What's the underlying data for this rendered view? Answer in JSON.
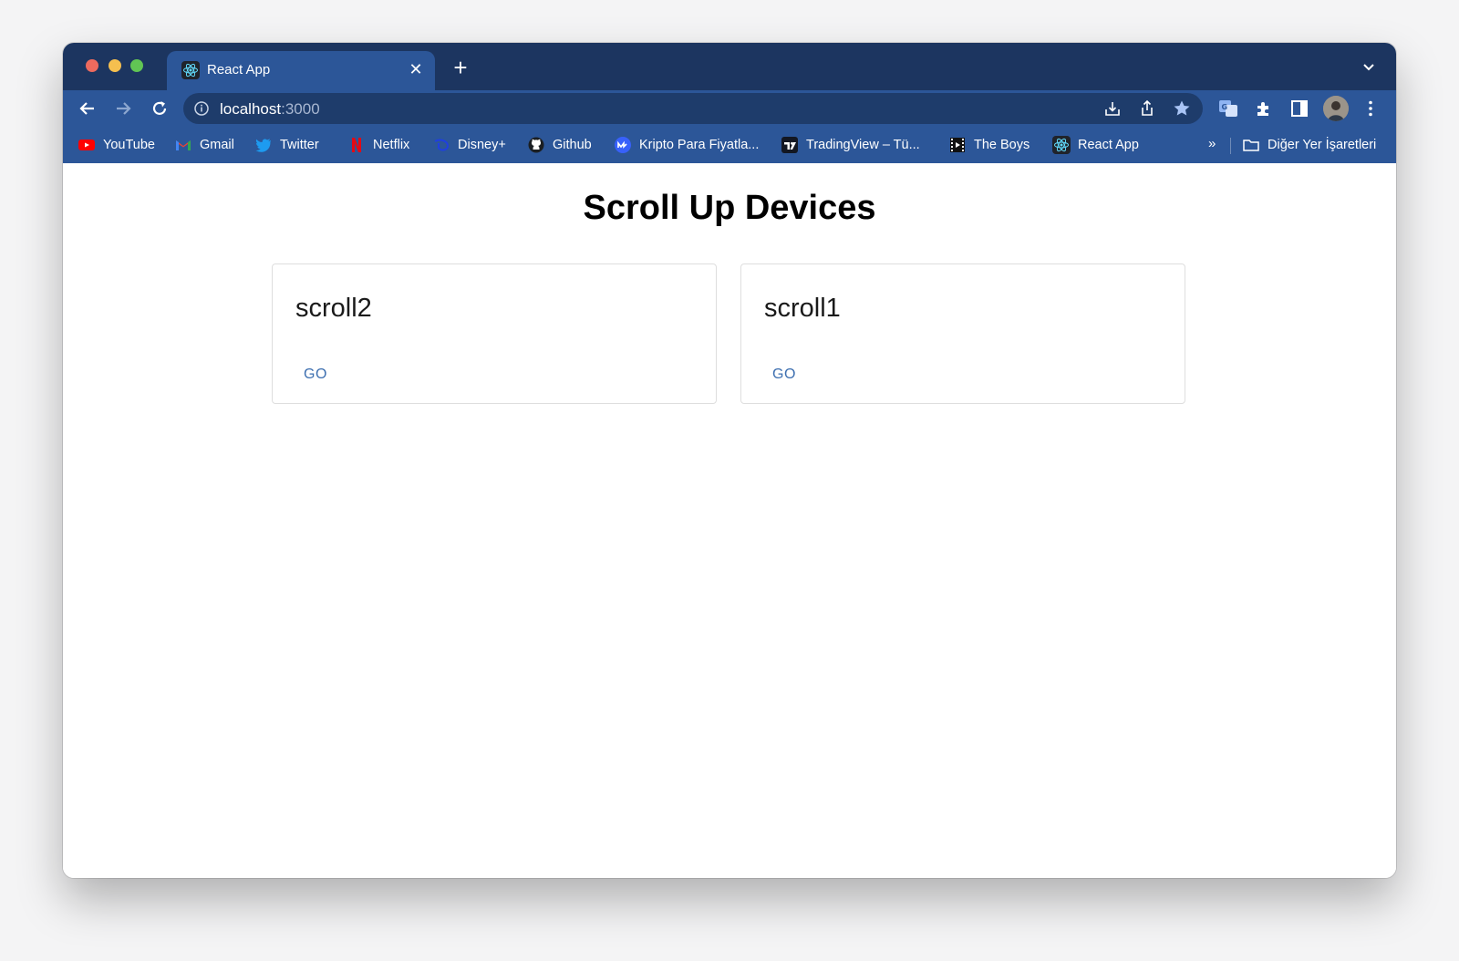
{
  "browser": {
    "tab": {
      "title": "React App",
      "close": "✕"
    },
    "new_tab": "+",
    "address": {
      "host": "localhost",
      "port": ":3000"
    },
    "bookmarks": [
      {
        "label": "YouTube",
        "icon": "youtube-icon"
      },
      {
        "label": "Gmail",
        "icon": "gmail-icon"
      },
      {
        "label": "Twitter",
        "icon": "twitter-icon"
      },
      {
        "label": "Netflix",
        "icon": "netflix-icon"
      },
      {
        "label": "Disney+",
        "icon": "disney-icon"
      },
      {
        "label": "Github",
        "icon": "github-icon"
      },
      {
        "label": "Kripto Para Fiyatla...",
        "icon": "coinmarket-icon"
      },
      {
        "label": "TradingView – Tü...",
        "icon": "tradingview-icon"
      },
      {
        "label": "The Boys",
        "icon": "film-icon"
      },
      {
        "label": "React App",
        "icon": "react-icon"
      }
    ],
    "bookmarks_more": "»",
    "other_bookmarks": "Diğer Yer İşaretleri"
  },
  "page": {
    "title": "Scroll Up Devices",
    "devices": [
      {
        "name": "scroll2",
        "action": "GO"
      },
      {
        "name": "scroll1",
        "action": "GO"
      }
    ]
  },
  "colors": {
    "tabstrip": "#1c3560",
    "toolbar": "#2c5698",
    "link": "#3d6fb0"
  }
}
